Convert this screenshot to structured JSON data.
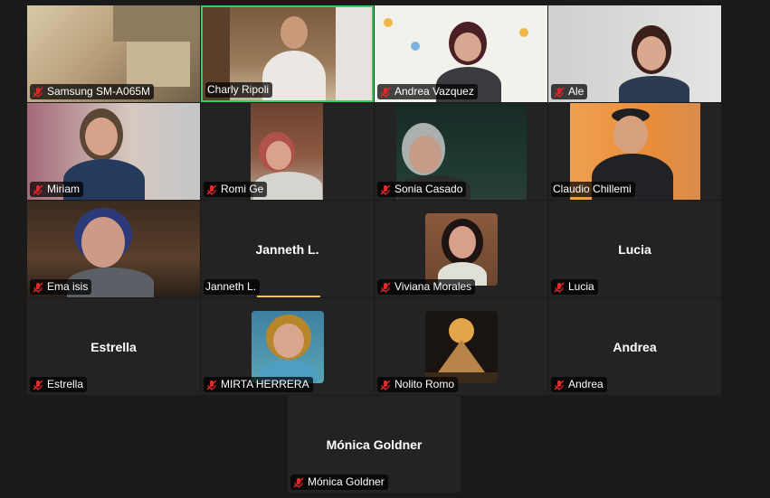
{
  "participants": [
    {
      "name": "Samsung SM-A065M",
      "muted": true
    },
    {
      "name": "Charly Ripoli",
      "muted": false,
      "active_speaker": true
    },
    {
      "name": "Andrea Vazquez",
      "muted": true
    },
    {
      "name": "Ale",
      "muted": true
    },
    {
      "name": "Miriam",
      "muted": true
    },
    {
      "name": "Romi Ge",
      "muted": true
    },
    {
      "name": "Sonia Casado",
      "muted": true
    },
    {
      "name": "Claudio Chillemi",
      "muted": false
    },
    {
      "name": "Ema isis",
      "muted": true
    },
    {
      "name": "Janneth L.",
      "muted": false,
      "display": "Janneth L."
    },
    {
      "name": "Viviana Morales",
      "muted": true
    },
    {
      "name": "Lucia",
      "muted": true,
      "display": "Lucia"
    },
    {
      "name": "Estrella",
      "muted": true,
      "display": "Estrella"
    },
    {
      "name": "MIRTA HERRERA",
      "muted": true
    },
    {
      "name": "Nolito Romo",
      "muted": true
    },
    {
      "name": "Andrea",
      "muted": true,
      "display": "Andrea"
    },
    {
      "name": "Mónica Goldner",
      "muted": true,
      "display": "Mónica Goldner"
    }
  ],
  "colors": {
    "active_border": "#2bd36b",
    "muted_icon": "#e02828",
    "background": "#1a1a1a"
  }
}
